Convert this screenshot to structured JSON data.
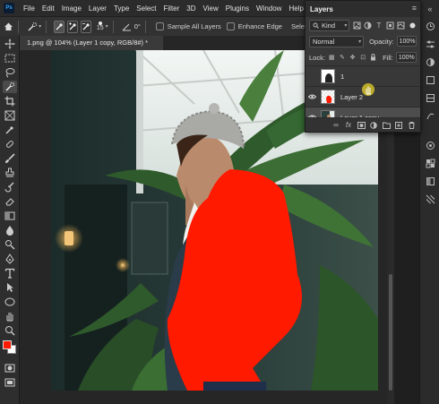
{
  "app": {
    "logo_text": "Ps"
  },
  "menu": [
    "File",
    "Edit",
    "Image",
    "Layer",
    "Type",
    "Select",
    "Filter",
    "3D",
    "View",
    "Plugins",
    "Window",
    "Help"
  ],
  "options_bar": {
    "brush_size": "15",
    "angle": "0°",
    "sample_all_layers": "Sample All Layers",
    "enhance_edge": "Enhance Edge",
    "select_subject_partial": "Sele"
  },
  "document_tab": {
    "title": "1.png @ 104% (Layer 1 copy, RGB/8#) *"
  },
  "layers_panel": {
    "title": "Layers",
    "filter_kind": "Kind",
    "blend_mode": "Normal",
    "opacity_label": "Opacity:",
    "opacity_value": "100%",
    "lock_label": "Lock:",
    "fill_label": "Fill:",
    "fill_value": "100%",
    "layers": [
      {
        "name": "1",
        "thumb": "dark-shape"
      },
      {
        "name": "Layer 2",
        "thumb": "red-shape"
      },
      {
        "name": "Layer 1 copy",
        "thumb": "photo",
        "selected": true
      }
    ]
  },
  "colors": {
    "foreground": "#ff1a00",
    "background": "#ffffff",
    "accent": "#31a8ff",
    "red_fill": "#ff1a00"
  }
}
